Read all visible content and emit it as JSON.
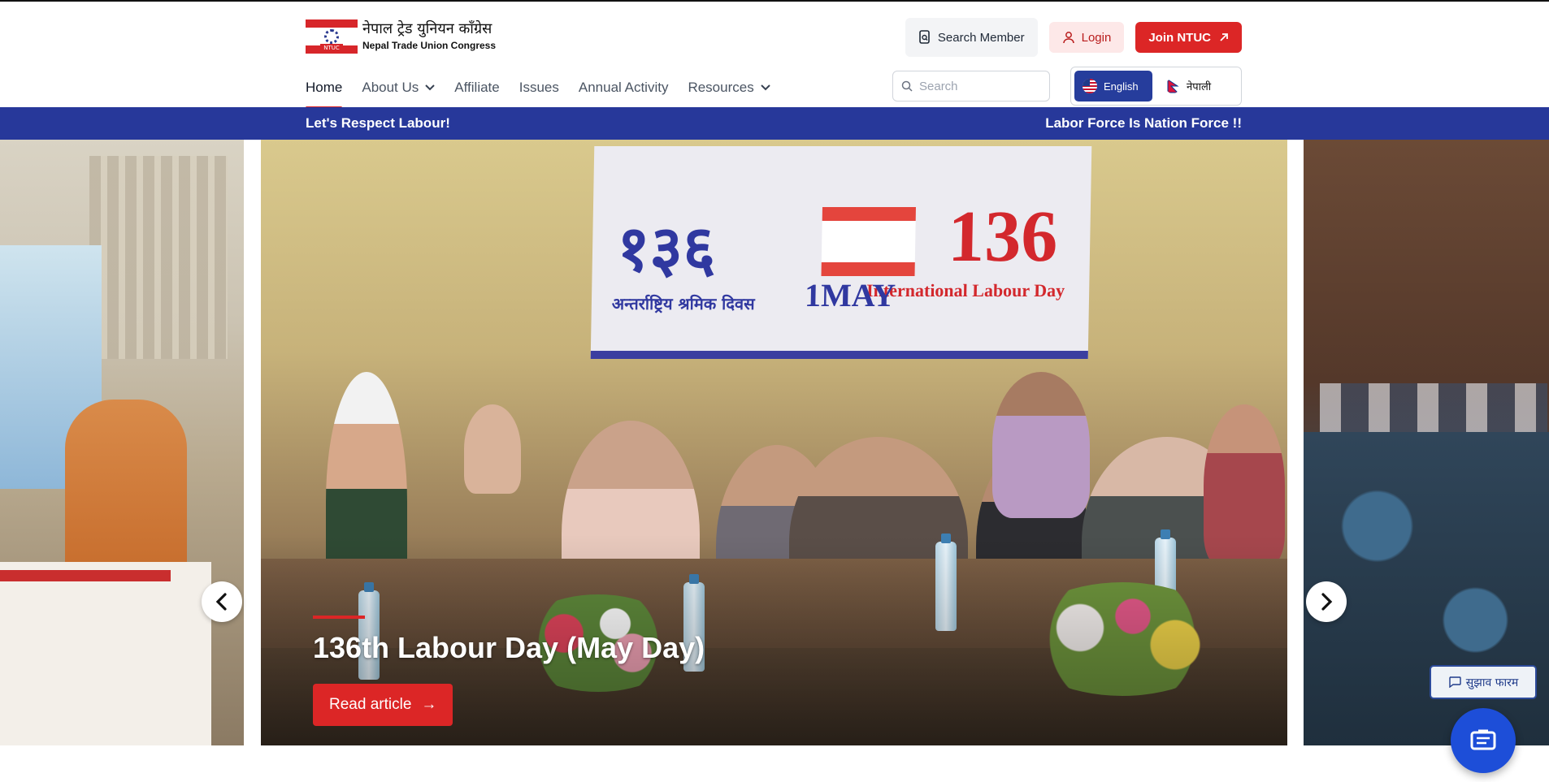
{
  "brand": {
    "name_np": "नेपाल ट्रेड युनियन काँग्रेस",
    "name_en": "Nepal Trade Union Congress",
    "logo_tag": "NTUC"
  },
  "top_actions": {
    "search_member": "Search Member",
    "login": "Login",
    "join": "Join NTUC"
  },
  "nav": {
    "items": [
      {
        "label": "Home",
        "active": true
      },
      {
        "label": "About Us",
        "dropdown": true
      },
      {
        "label": "Affiliate"
      },
      {
        "label": "Issues"
      },
      {
        "label": "Annual Activity"
      },
      {
        "label": "Resources",
        "dropdown": true
      }
    ]
  },
  "search": {
    "placeholder": "Search"
  },
  "language": {
    "english": "English",
    "nepali": "नेपाली",
    "selected": "English"
  },
  "ticker": {
    "left": "Let's Respect Labour!",
    "right": "Labor Force Is Nation Force !!"
  },
  "carousel": {
    "slide_title": "136th Labour Day (May Day)",
    "read_label": "Read article",
    "read_arrow": "→",
    "banner": {
      "left_text": "१३६",
      "right_text": "136",
      "sub_text": "International Labour Day",
      "may_text": "1MAY",
      "np_text": "अन्तर्राष्ट्रिय श्रमिक दिवस"
    }
  },
  "feedback": {
    "tab_label": "सुझाव फारम"
  },
  "colors": {
    "brand_red": "#dc2626",
    "ticker_blue": "#27389a",
    "lang_blue": "#263d9c",
    "fab_blue": "#1d4ed8"
  }
}
